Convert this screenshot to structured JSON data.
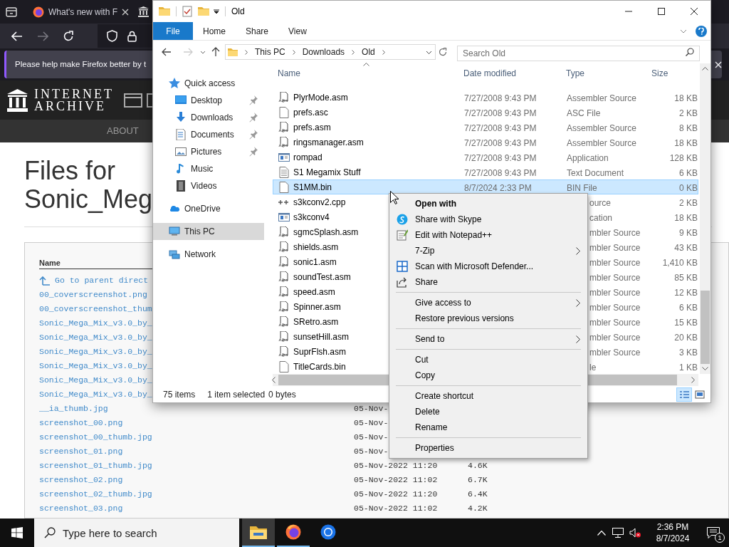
{
  "browser": {
    "tab": {
      "title": "What's new with F"
    },
    "notification": "Please help make Firefox better by t",
    "site": {
      "logo_lines": [
        "INTERNET",
        "ARCHIVE"
      ],
      "nav": [
        "ABOUT"
      ]
    },
    "heading": "Files for Sonic_Meg",
    "listing": {
      "header": "Name",
      "rows": [
        {
          "kind": "parent",
          "name": "Go to parent direct"
        },
        {
          "kind": "file",
          "name": "00_coverscreenshot.png"
        },
        {
          "kind": "file",
          "name": "00_coverscreenshot_thum"
        },
        {
          "kind": "file",
          "name": "Sonic_Mega_Mix_v3.0_by_"
        },
        {
          "kind": "file",
          "name": "Sonic_Mega_Mix_v3.0_by_"
        },
        {
          "kind": "file",
          "name": "Sonic_Mega_Mix_v3.0_by_"
        },
        {
          "kind": "file",
          "name": "Sonic_Mega_Mix_v3.0_by_"
        },
        {
          "kind": "file",
          "name": "Sonic_Mega_Mix_v3.0_by_"
        },
        {
          "kind": "file",
          "name": "Sonic_Mega_Mix_v3.0_by_"
        },
        {
          "kind": "file",
          "name": "__ia_thumb.jpg",
          "date": "05-Nov-"
        },
        {
          "kind": "file",
          "name": "screenshot_00.png",
          "date": "05-Nov-"
        },
        {
          "kind": "file",
          "name": "screenshot_00_thumb.jpg",
          "date": "05-Nov-"
        },
        {
          "kind": "file",
          "name": "screenshot_01.png",
          "date": "05-Nov-"
        },
        {
          "kind": "file",
          "name": "screenshot_01_thumb.jpg",
          "date": "05-Nov-2022 11:20",
          "size": "4.6K"
        },
        {
          "kind": "file",
          "name": "screenshot_02.png",
          "date": "05-Nov-2022 11:02",
          "size": "6.7K"
        },
        {
          "kind": "file",
          "name": "screenshot_02_thumb.jpg",
          "date": "05-Nov-2022 11:20",
          "size": "6.4K"
        },
        {
          "kind": "file",
          "name": "screenshot_03.png",
          "date": "05-Nov-2022 11:02",
          "size": "4.2K"
        }
      ]
    }
  },
  "explorer": {
    "title": "Old",
    "ribbon_tabs": [
      {
        "kind": "menu",
        "label": "File"
      },
      {
        "kind": "tab",
        "label": "Home"
      },
      {
        "kind": "tab",
        "label": "Share"
      },
      {
        "kind": "tab",
        "label": "View"
      }
    ],
    "breadcrumb": [
      "This PC",
      "Downloads",
      "Old"
    ],
    "search": {
      "placeholder": "Search Old"
    },
    "nav": [
      {
        "label": "Quick access",
        "selected": false,
        "children": [
          {
            "label": "Desktop",
            "pinned": true,
            "selected": false
          },
          {
            "label": "Downloads",
            "pinned": true,
            "selected": false
          },
          {
            "label": "Documents",
            "pinned": true,
            "selected": false
          },
          {
            "label": "Pictures",
            "pinned": true,
            "selected": false
          },
          {
            "label": "Music",
            "pinned": false,
            "selected": false
          },
          {
            "label": "Videos",
            "pinned": false,
            "selected": false
          }
        ]
      },
      {
        "label": "OneDrive",
        "selected": false
      },
      {
        "label": "This PC",
        "selected": true
      },
      {
        "label": "Network",
        "selected": false
      }
    ],
    "columns": [
      "Name",
      "Date modified",
      "Type",
      "Size"
    ],
    "files": [
      {
        "kind": "asm",
        "name": "PlyrMode.asm",
        "date": "7/27/2008 9:43 PM",
        "type": "Assembler Source",
        "size": "18 KB",
        "selected": false
      },
      {
        "kind": "blank",
        "name": "prefs.asc",
        "date": "7/27/2008 9:43 PM",
        "type": "ASC File",
        "size": "2 KB",
        "selected": false
      },
      {
        "kind": "asm",
        "name": "prefs.asm",
        "date": "7/27/2008 9:43 PM",
        "type": "Assembler Source",
        "size": "8 KB",
        "selected": false
      },
      {
        "kind": "asm",
        "name": "ringsmanager.asm",
        "date": "7/27/2008 9:43 PM",
        "type": "Assembler Source",
        "size": "18 KB",
        "selected": false
      },
      {
        "kind": "app",
        "name": "rompad",
        "date": "7/27/2008 9:43 PM",
        "type": "Application",
        "size": "128 KB",
        "selected": false
      },
      {
        "kind": "text",
        "name": "S1 Megamix Stuff",
        "date": "7/27/2008 9:43 PM",
        "type": "Text Document",
        "size": "6 KB",
        "selected": false
      },
      {
        "kind": "blank",
        "name": "S1MM.bin",
        "date": "8/7/2024 2:33 PM",
        "type": "BIN File",
        "size": "0 KB",
        "selected": true
      },
      {
        "kind": "cpp",
        "name": "s3kconv2.cpp",
        "type": "ource",
        "size": "2 KB",
        "selected": false
      },
      {
        "kind": "app",
        "name": "s3kconv4",
        "type": "cation",
        "size": "18 KB",
        "selected": false
      },
      {
        "kind": "asm",
        "name": "sgmcSplash.asm",
        "type": "mbler Source",
        "size": "9 KB",
        "selected": false
      },
      {
        "kind": "asm",
        "name": "shields.asm",
        "type": "mbler Source",
        "size": "43 KB",
        "selected": false
      },
      {
        "kind": "asm",
        "name": "sonic1.asm",
        "type": "mbler Source",
        "size": "1,410 KB",
        "selected": false
      },
      {
        "kind": "asm",
        "name": "soundTest.asm",
        "type": "mbler Source",
        "size": "85 KB",
        "selected": false
      },
      {
        "kind": "asm",
        "name": "speed.asm",
        "type": "mbler Source",
        "size": "12 KB",
        "selected": false
      },
      {
        "kind": "asm",
        "name": "Spinner.asm",
        "type": "mbler Source",
        "size": "6 KB",
        "selected": false
      },
      {
        "kind": "asm",
        "name": "SRetro.asm",
        "type": "mbler Source",
        "size": "15 KB",
        "selected": false
      },
      {
        "kind": "asm",
        "name": "sunsetHill.asm",
        "type": "mbler Source",
        "size": "20 KB",
        "selected": false
      },
      {
        "kind": "asm",
        "name": "SuprFlsh.asm",
        "type": "mbler Source",
        "size": "3 KB",
        "selected": false
      },
      {
        "kind": "blank",
        "name": "TitleCards.bin",
        "type": "le",
        "size": "1 KB",
        "selected": false
      }
    ],
    "status": {
      "items": "75 items",
      "selection": "1 item selected",
      "size": "0 bytes"
    },
    "views": [
      {
        "selected": true
      },
      {
        "selected": false
      }
    ]
  },
  "context_menu": {
    "items": [
      {
        "kind": "item",
        "label": "Open with",
        "default": true,
        "submenu": false
      },
      {
        "kind": "item",
        "label": "Share with Skype",
        "default": false,
        "submenu": false
      },
      {
        "kind": "item",
        "label": "Edit with Notepad++",
        "default": false,
        "submenu": false
      },
      {
        "kind": "item",
        "label": "7-Zip",
        "default": false,
        "submenu": true
      },
      {
        "kind": "item",
        "label": "Scan with Microsoft Defender...",
        "default": false,
        "submenu": false
      },
      {
        "kind": "item",
        "label": "Share",
        "default": false,
        "submenu": false
      },
      {
        "kind": "separator"
      },
      {
        "kind": "item",
        "label": "Give access to",
        "default": false,
        "submenu": true
      },
      {
        "kind": "item",
        "label": "Restore previous versions",
        "default": false,
        "submenu": false
      },
      {
        "kind": "separator"
      },
      {
        "kind": "item",
        "label": "Send to",
        "default": false,
        "submenu": true
      },
      {
        "kind": "separator"
      },
      {
        "kind": "item",
        "label": "Cut",
        "default": false,
        "submenu": false
      },
      {
        "kind": "item",
        "label": "Copy",
        "default": false,
        "submenu": false
      },
      {
        "kind": "separator"
      },
      {
        "kind": "item",
        "label": "Create shortcut",
        "default": false,
        "submenu": false
      },
      {
        "kind": "item",
        "label": "Delete",
        "default": false,
        "submenu": false
      },
      {
        "kind": "item",
        "label": "Rename",
        "default": false,
        "submenu": false
      },
      {
        "kind": "separator"
      },
      {
        "kind": "item",
        "label": "Properties",
        "default": false,
        "submenu": false
      }
    ]
  },
  "taskbar": {
    "search": {
      "placeholder": "Type here to search"
    },
    "apps": [
      {
        "selected": true,
        "running": true
      },
      {
        "selected": false,
        "running": true
      },
      {
        "selected": false,
        "running": false
      }
    ],
    "clock": {
      "time": "2:36 PM",
      "date": "8/7/2024"
    },
    "notifications": "1"
  }
}
